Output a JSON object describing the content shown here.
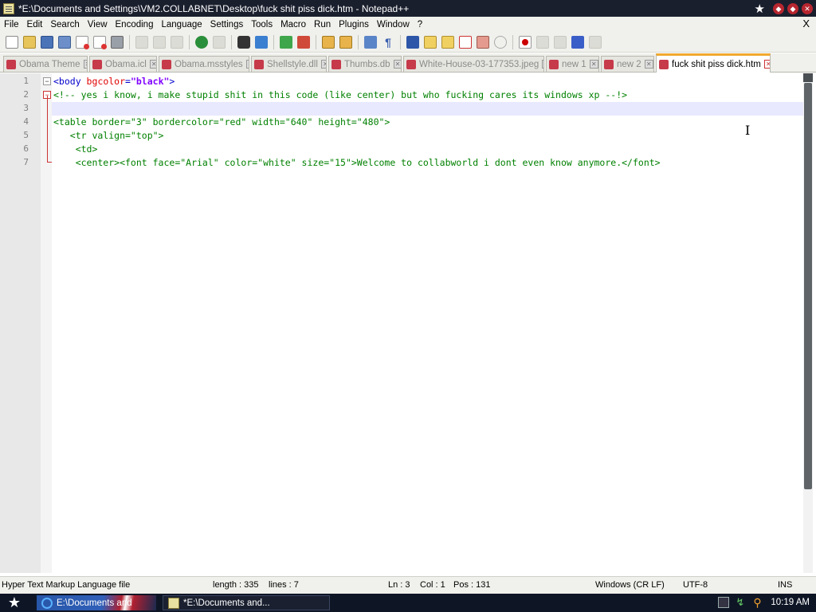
{
  "window": {
    "title": "*E:\\Documents and Settings\\VM2.COLLABNET\\Desktop\\fuck shit piss dick.htm - Notepad++",
    "menu_close": "X"
  },
  "menu": [
    "File",
    "Edit",
    "Search",
    "View",
    "Encoding",
    "Language",
    "Settings",
    "Tools",
    "Macro",
    "Run",
    "Plugins",
    "Window",
    "?"
  ],
  "tabs": [
    {
      "label": "Obama Theme",
      "active": false
    },
    {
      "label": "Obama.icl",
      "active": false
    },
    {
      "label": "Obama.msstyles",
      "active": false
    },
    {
      "label": "Shellstyle.dll",
      "active": false
    },
    {
      "label": "Thumbs.db",
      "active": false
    },
    {
      "label": "White-House-03-177353.jpeg",
      "active": false
    },
    {
      "label": "new 1",
      "active": false
    },
    {
      "label": "new 2",
      "active": false
    },
    {
      "label": "fuck shit piss dick.htm",
      "active": true
    }
  ],
  "editor": {
    "line_numbers": [
      "1",
      "2",
      "3",
      "4",
      "5",
      "6",
      "7"
    ],
    "lines": {
      "l1_open": "<body ",
      "l1_attr": "bgcolor",
      "l1_eq": "=",
      "l1_val": "\"black\"",
      "l1_close": ">",
      "l2": "<!-- yes i know, i make stupid shit in this code (like center) but who fucking cares its windows xp --!>",
      "l4": "<table border=\"3\" bordercolor=\"red\" width=\"640\" height=\"480\">",
      "l5": "   <tr valign=\"top\">",
      "l6": "    <td>",
      "l7": "    <center><font face=\"Arial\" color=\"white\" size=\"15\">Welcome to collabworld i dont even know anymore.</font>"
    }
  },
  "status": {
    "file_type": "Hyper Text Markup Language file",
    "length": "length : 335",
    "lines": "lines : 7",
    "ln": "Ln : 3",
    "col": "Col : 1",
    "pos": "Pos : 131",
    "eol": "Windows (CR LF)",
    "encoding": "UTF-8",
    "mode": "INS"
  },
  "taskbar": {
    "items": [
      {
        "label": "E:\\Documents and",
        "icon": "ie-icon"
      },
      {
        "label": "*E:\\Documents and...",
        "icon": "notepad-icon"
      }
    ],
    "clock": "10:19 AM"
  },
  "colors": {
    "tag": "#0000cc",
    "attribute": "#e00000",
    "value": "#8000ff",
    "comment": "#008000",
    "active_tab_accent": "#f0a830",
    "caret_line": "#e8e8ff"
  }
}
